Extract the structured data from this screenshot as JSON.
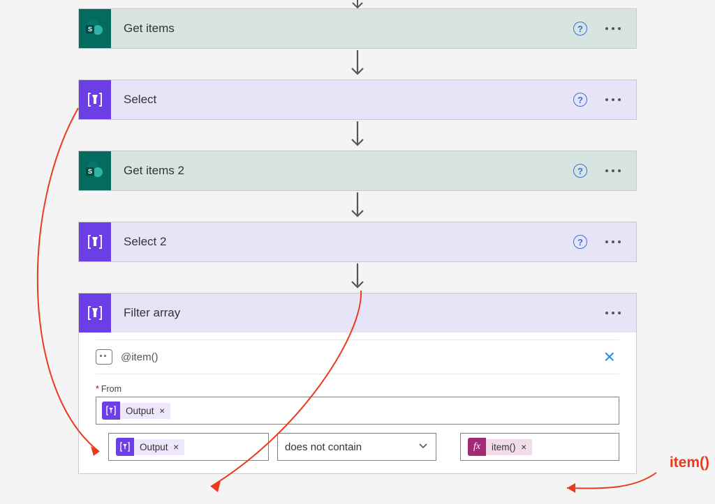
{
  "steps": {
    "get_items": {
      "title": "Get items"
    },
    "select": {
      "title": "Select"
    },
    "get_items2": {
      "title": "Get items 2"
    },
    "select2": {
      "title": "Select 2"
    },
    "filter": {
      "title": "Filter array",
      "rename_text": "@item()",
      "from_label": "From",
      "from_token": "Output",
      "cond_left_token": "Output",
      "cond_operator": "does not contain",
      "cond_right_token": "item()"
    }
  },
  "annotation": {
    "right_label": "item()"
  },
  "icons": {
    "help_glyph": "?",
    "close_glyph": "×",
    "remove_glyph": "×",
    "fx_glyph": "fx",
    "sp_letter": "S"
  }
}
